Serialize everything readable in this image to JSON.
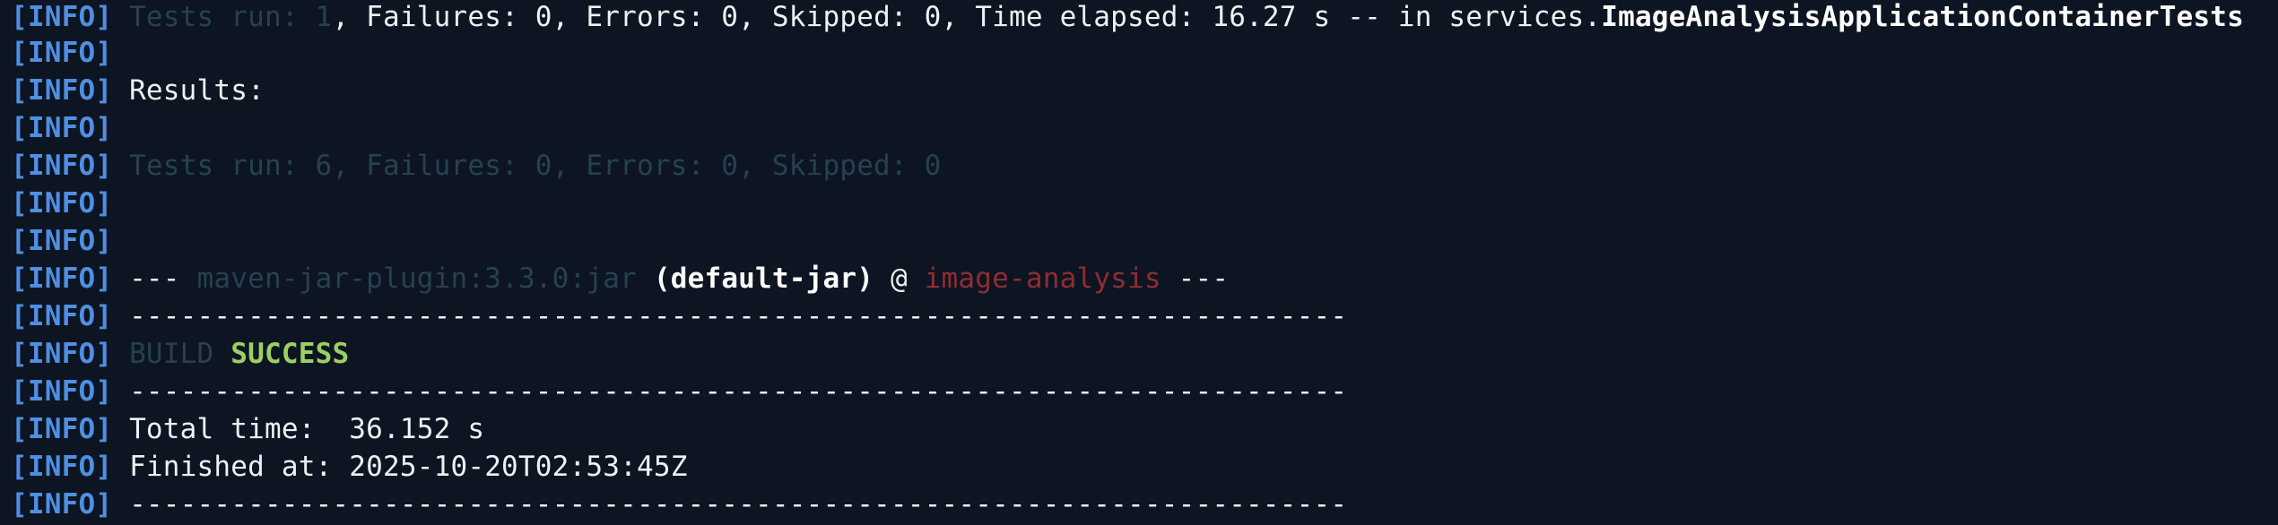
{
  "terminal": {
    "colors": {
      "background": "#0d1522",
      "info_tag": "#4f8fe3",
      "dim_text": "#26414f",
      "normal_text": "#eef0f3",
      "success": "#9ccf63",
      "artifact": "#8f2d33"
    },
    "lines": [
      {
        "tag": "[INFO]",
        "dim_prefix": "Tests run: 1",
        "text": ", Failures: 0, Errors: 0, Skipped: 0, Time elapsed: 16.27 s -- in services.",
        "strong": "ImageAnalysisApplicationContainerTests"
      },
      {
        "tag": "[INFO]"
      },
      {
        "tag": "[INFO]",
        "text": "Results:"
      },
      {
        "tag": "[INFO]"
      },
      {
        "tag": "[INFO]",
        "dim": "Tests run: 6, Failures: 0, Errors: 0, Skipped: 0"
      },
      {
        "tag": "[INFO]"
      },
      {
        "tag": "[INFO]"
      },
      {
        "tag": "[INFO]",
        "text_start": "--- ",
        "plugin": "maven-jar-plugin:3.3.0:jar",
        "goal": "(default-jar)",
        "at": " @ ",
        "artifact": "image-analysis",
        "text_end": " ---"
      },
      {
        "tag": "[INFO]",
        "separator": "------------------------------------------------------------------------"
      },
      {
        "tag": "[INFO]",
        "build_label": "BUILD",
        "build_status": "SUCCESS"
      },
      {
        "tag": "[INFO]",
        "separator": "------------------------------------------------------------------------"
      },
      {
        "tag": "[INFO]",
        "text": "Total time:  36.152 s"
      },
      {
        "tag": "[INFO]",
        "text": "Finished at: 2025-10-20T02:53:45Z"
      },
      {
        "tag": "[INFO]",
        "separator": "------------------------------------------------------------------------"
      }
    ]
  }
}
